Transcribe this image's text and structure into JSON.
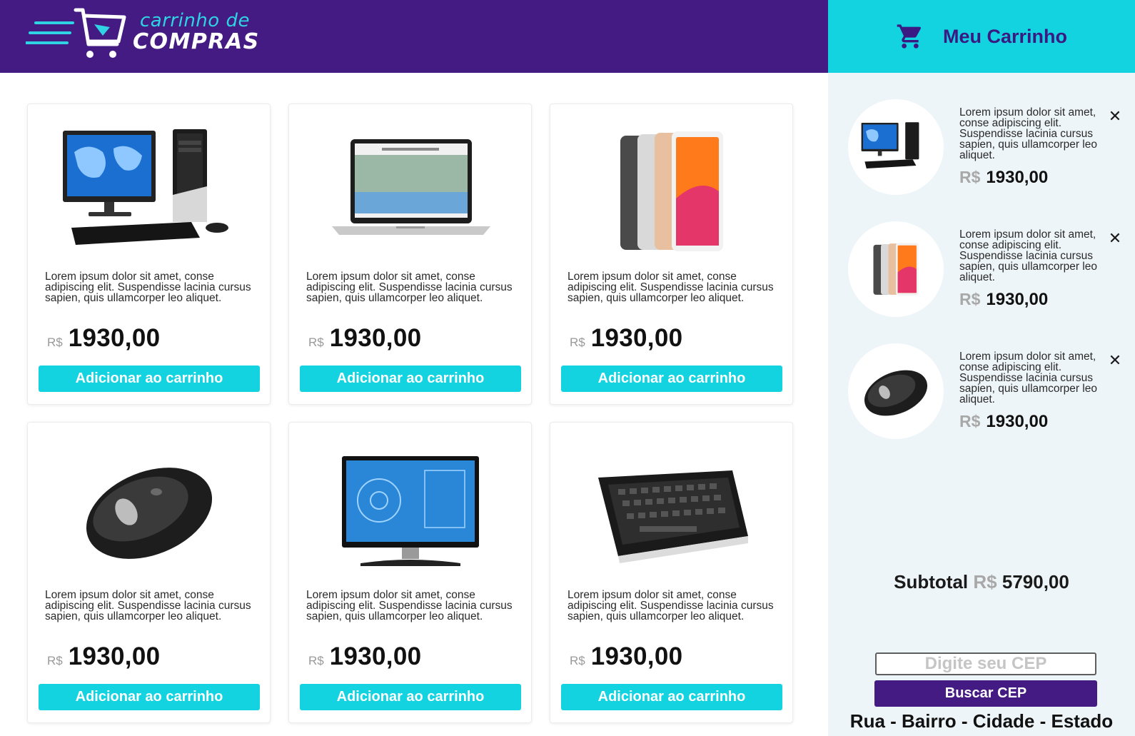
{
  "header": {
    "logo_line1": "carrinho de",
    "logo_line2": "COMPRAS",
    "colors": {
      "primary": "#431b82",
      "accent": "#13d3e0"
    }
  },
  "products": [
    {
      "image": "desktop-computer",
      "description": "Lorem ipsum dolor sit amet, conse adipiscing elit. Suspendisse lacinia cursus sapien, quis ullamcorper leo aliquet.",
      "currency": "R$",
      "price": "1930,00",
      "button_label": "Adicionar ao carrinho"
    },
    {
      "image": "laptop",
      "description": "Lorem ipsum dolor sit amet, conse adipiscing elit. Suspendisse lacinia cursus sapien, quis ullamcorper leo aliquet.",
      "currency": "R$",
      "price": "1930,00",
      "button_label": "Adicionar ao carrinho"
    },
    {
      "image": "tablets",
      "description": "Lorem ipsum dolor sit amet, conse adipiscing elit. Suspendisse lacinia cursus sapien, quis ullamcorper leo aliquet.",
      "currency": "R$",
      "price": "1930,00",
      "button_label": "Adicionar ao carrinho"
    },
    {
      "image": "mouse",
      "description": "Lorem ipsum dolor sit amet, conse adipiscing elit. Suspendisse lacinia cursus sapien, quis ullamcorper leo aliquet.",
      "currency": "R$",
      "price": "1930,00",
      "button_label": "Adicionar ao carrinho"
    },
    {
      "image": "monitor",
      "description": "Lorem ipsum dolor sit amet, conse adipiscing elit. Suspendisse lacinia cursus sapien, quis ullamcorper leo aliquet.",
      "currency": "R$",
      "price": "1930,00",
      "button_label": "Adicionar ao carrinho"
    },
    {
      "image": "keyboard",
      "description": "Lorem ipsum dolor sit amet, conse adipiscing elit. Suspendisse lacinia cursus sapien, quis ullamcorper leo aliquet.",
      "currency": "R$",
      "price": "1930,00",
      "button_label": "Adicionar ao carrinho"
    }
  ],
  "cart": {
    "title": "Meu Carrinho",
    "items": [
      {
        "image": "desktop-computer",
        "description": "Lorem ipsum dolor sit amet, conse adipiscing elit. Suspendisse lacinia cursus sapien, quis ullamcorper leo aliquet.",
        "currency": "R$",
        "price": "1930,00",
        "remove_label": "✕"
      },
      {
        "image": "tablets",
        "description": "Lorem ipsum dolor sit amet, conse adipiscing elit. Suspendisse lacinia cursus sapien, quis ullamcorper leo aliquet.",
        "currency": "R$",
        "price": "1930,00",
        "remove_label": "✕"
      },
      {
        "image": "mouse",
        "description": "Lorem ipsum dolor sit amet, conse adipiscing elit. Suspendisse lacinia cursus sapien, quis ullamcorper leo aliquet.",
        "currency": "R$",
        "price": "1930,00",
        "remove_label": "✕"
      }
    ],
    "subtotal_label": "Subtotal",
    "subtotal_currency": "R$",
    "subtotal_value": "5790,00",
    "cep_placeholder": "Digite seu CEP",
    "cep_button": "Buscar CEP",
    "address": "Rua - Bairro - Cidade - Estado"
  }
}
